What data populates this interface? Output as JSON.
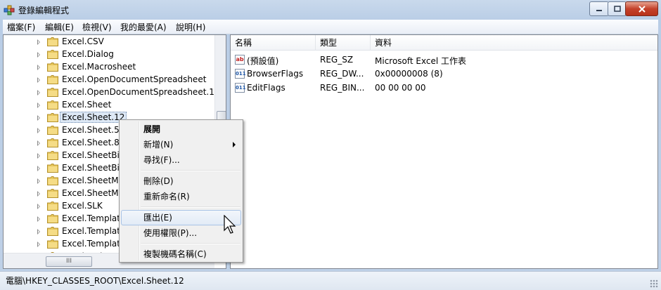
{
  "window": {
    "title": "登錄編輯程式"
  },
  "menu": [
    "檔案(F)",
    "編輯(E)",
    "檢視(V)",
    "我的最愛(A)",
    "說明(H)"
  ],
  "tree": {
    "items": [
      {
        "label": "Excel.CSV"
      },
      {
        "label": "Excel.Dialog"
      },
      {
        "label": "Excel.Macrosheet"
      },
      {
        "label": "Excel.OpenDocumentSpreadsheet"
      },
      {
        "label": "Excel.OpenDocumentSpreadsheet.12"
      },
      {
        "label": "Excel.Sheet"
      },
      {
        "label": "Excel.Sheet.12",
        "selected": true
      },
      {
        "label": "Excel.Sheet.5"
      },
      {
        "label": "Excel.Sheet.8"
      },
      {
        "label": "Excel.SheetBin"
      },
      {
        "label": "Excel.SheetBin"
      },
      {
        "label": "Excel.SheetMa"
      },
      {
        "label": "Excel.SheetMa"
      },
      {
        "label": "Excel.SLK"
      },
      {
        "label": "Excel.Templat"
      },
      {
        "label": "Excel.Templat"
      },
      {
        "label": "Excel.Templat"
      },
      {
        "label": "Excel.WebQu"
      }
    ],
    "hscroll_grip": "III"
  },
  "values": {
    "columns": [
      "名稱",
      "類型",
      "資料"
    ],
    "rows": [
      {
        "icon": "string-value-icon",
        "glyph": "ab",
        "name": "(預設值)",
        "type": "REG_SZ",
        "data": "Microsoft Excel 工作表"
      },
      {
        "icon": "binary-value-icon",
        "glyph": "011",
        "name": "BrowserFlags",
        "type": "REG_DW...",
        "data": "0x00000008 (8)"
      },
      {
        "icon": "binary-value-icon",
        "glyph": "011",
        "name": "EditFlags",
        "type": "REG_BIN...",
        "data": "00 00 00 00"
      }
    ]
  },
  "context_menu": {
    "expand": "展開",
    "new": "新增(N)",
    "find": "尋找(F)...",
    "delete": "刪除(D)",
    "rename": "重新命名(R)",
    "export": "匯出(E)",
    "permissions": "使用權限(P)...",
    "copy_key_name": "複製機碼名稱(C)"
  },
  "status": {
    "path": "電腦\\HKEY_CLASSES_ROOT\\Excel.Sheet.12"
  }
}
